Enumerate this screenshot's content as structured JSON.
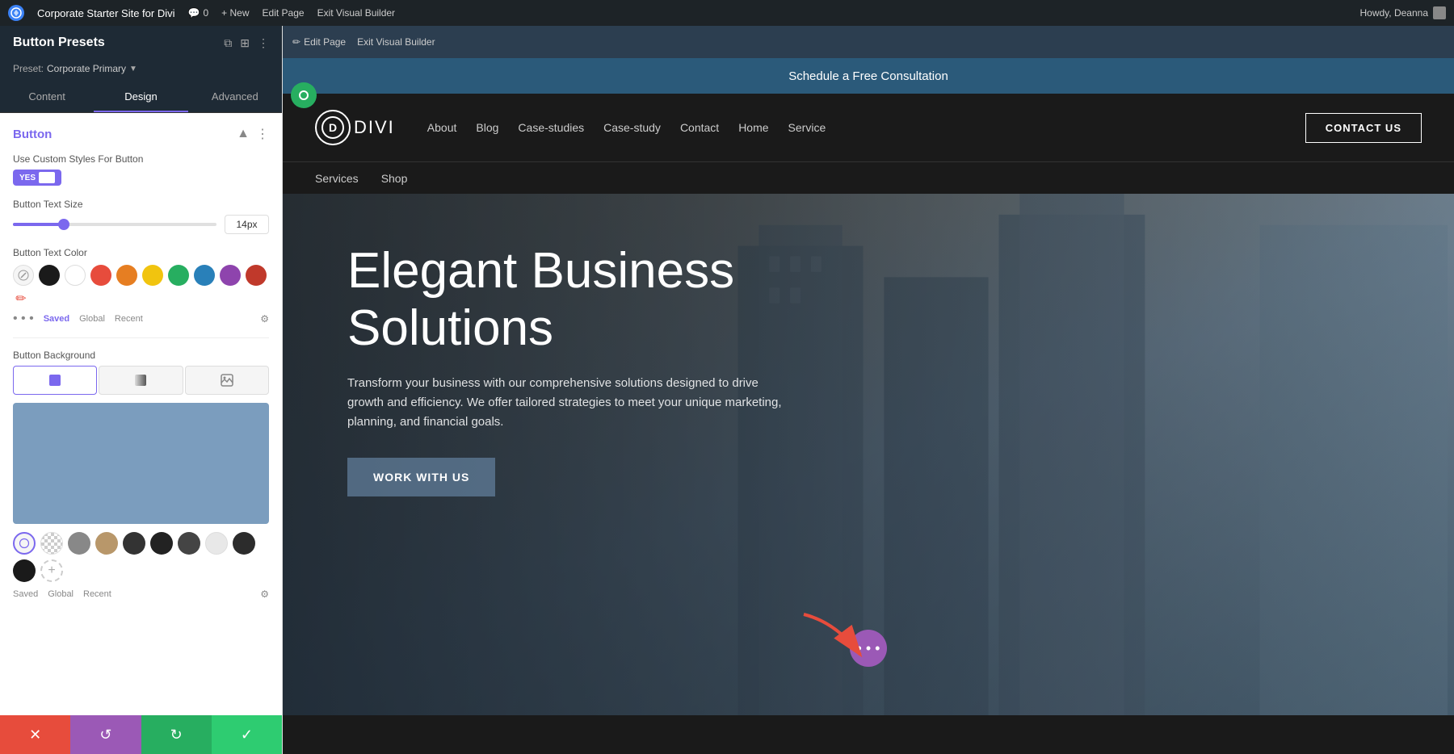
{
  "admin_bar": {
    "wp_logo": "W",
    "site_name": "Corporate Starter Site for Divi",
    "comments": "0",
    "new_label": "+ New",
    "edit_page": "Edit Page",
    "exit_builder": "Exit Visual Builder",
    "howdy": "Howdy, Deanna"
  },
  "panel": {
    "title": "Button Presets",
    "preset_label": "Preset:",
    "preset_value": "Corporate Primary",
    "tabs": [
      "Content",
      "Design",
      "Advanced"
    ],
    "active_tab": "Design",
    "section_title": "Button",
    "toggle_label": "Use Custom Styles For Button",
    "toggle_value": "YES",
    "text_size_label": "Button Text Size",
    "text_size_value": "14px",
    "text_color_label": "Button Text Color",
    "background_label": "Button Background",
    "color_tabs": [
      "Saved",
      "Global",
      "Recent"
    ],
    "active_color_tab": "Saved"
  },
  "divi_bar": {
    "items": [
      "Edit Page",
      "Exit Visual Builder"
    ],
    "new_label": "+ New"
  },
  "preview": {
    "top_bar_text": "Schedule a Free Consultation",
    "logo_text": "DIVI",
    "nav_links": [
      "About",
      "Blog",
      "Case-studies",
      "Case-study",
      "Contact",
      "Home",
      "Service"
    ],
    "nav_links_2": [
      "Services",
      "Shop"
    ],
    "contact_btn": "CONTACT US",
    "hero_title": "Elegant Business Solutions",
    "hero_subtitle": "Transform your business with our comprehensive solutions designed to drive growth and efficiency. We offer tailored strategies to meet your unique marketing, planning, and financial goals.",
    "hero_cta": "WORK WITH US"
  },
  "footer_buttons": {
    "cancel": "✕",
    "reset": "↺",
    "redo": "↻",
    "save": "✓"
  }
}
